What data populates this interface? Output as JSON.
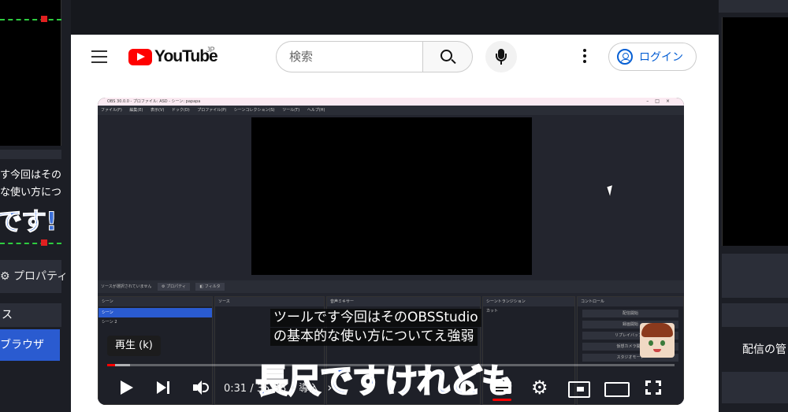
{
  "background_left": {
    "subtitle_line1": "す今回はその",
    "subtitle_line2": "な使い方につ",
    "big_caption": "です!",
    "properties_label": "⚙ プロパティ",
    "sources_header": "ス",
    "source_item": "ブラウザ"
  },
  "background_right": {
    "manage_label": "配信の管"
  },
  "masthead": {
    "logo_text": "YouTube",
    "region": "JP",
    "search_placeholder": "検索",
    "login_label": "ログイン"
  },
  "video": {
    "obs_title": "OBS 30.0.0 - プロファイル: ASD - シーン: papapa",
    "obs_menu": "ファイル(F) 編集(E) 表示(V) ドック(D) プロファイル(P) シーンコレクション(S) ツール(T) ヘルプ(H)",
    "obs_status": "ソースが選択されていません",
    "obs_prop_tag": "⚙ プロパティ",
    "obs_filter_tag": "◧ フィルタ",
    "dock_scenes": "シーン",
    "dock_sources": "ソース",
    "dock_mixer": "音声ミキサー",
    "dock_transitions": "シーントランジション",
    "dock_controls": "コントロール",
    "scene_selected": "シーン",
    "scene_2": "シーン 2",
    "transition_value": "カット",
    "control_buttons": [
      "配信開始",
      "録画開始",
      "リプレイバッファ",
      "仮想カメラ開始",
      "スタジオモード"
    ],
    "subtitle_line1": "ツールです今回はそのOBSStudio",
    "subtitle_line2": "の基本的な使い方についてえ強弱",
    "big_caption": "長尺ですけれども",
    "play_tooltip": "再生 (k)",
    "time_display": "0:31 / 35:38",
    "chapter_label": "• 導入",
    "progress_played": 0.014,
    "progress_buffered": 0.04
  }
}
